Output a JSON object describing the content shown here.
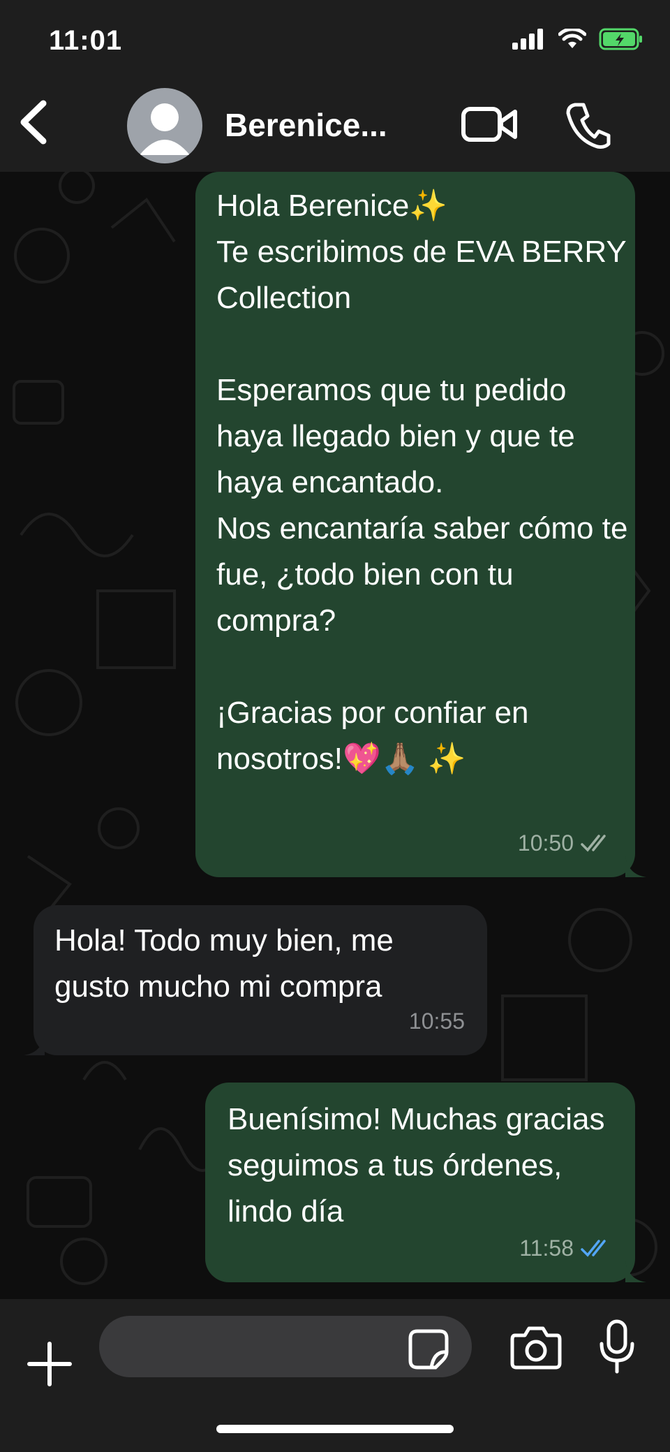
{
  "status": {
    "time": "11:01"
  },
  "header": {
    "contact_name": "Berenice...",
    "back_icon": "chevron-left-icon",
    "video_icon": "video-camera-icon",
    "call_icon": "phone-icon"
  },
  "messages": [
    {
      "direction": "outgoing",
      "text": "Hola Berenice✨\nTe escribimos de EVA BERRY Collection\n\nEsperamos que tu pedido haya llegado bien y que te haya encantado.\nNos encantaría saber cómo te fue, ¿todo bien con tu compra?\n\n¡Gracias por confiar en nosotros!💖🙏🏽 ✨",
      "time": "10:50",
      "status": "delivered"
    },
    {
      "direction": "incoming",
      "text": "Hola! Todo muy bien, me gusto mucho mi compra",
      "time": "10:55"
    },
    {
      "direction": "outgoing",
      "text": "Buenísimo! Muchas gracias seguimos a tus órdenes, lindo día",
      "time": "11:58",
      "status": "read"
    }
  ],
  "composer": {
    "placeholder": ""
  },
  "colors": {
    "outgoing_bubble": "#23452f",
    "incoming_bubble": "#1f2022",
    "read_ticks": "#53a6f5",
    "delivered_ticks": "#9fb1a4",
    "battery": "#53d769"
  }
}
